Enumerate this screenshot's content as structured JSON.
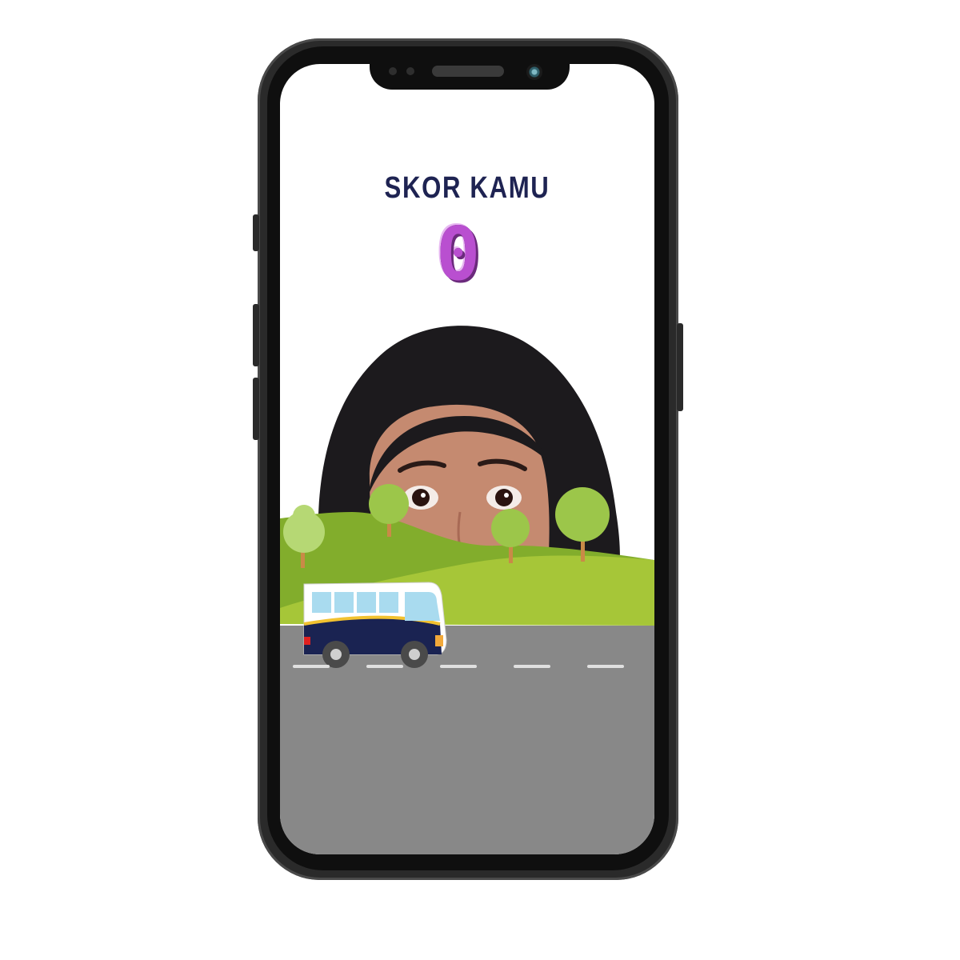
{
  "score": {
    "label": "SKOR KAMU",
    "value": "0"
  },
  "scene": {
    "vehicle": "bus-icon",
    "background": "hills-with-trees",
    "person": "peeking-face"
  },
  "colors": {
    "score_label": "#1e2352",
    "score_value": "#b94fd0",
    "hill_light": "#a6c638",
    "hill_dark": "#82ad2c",
    "road": "#888888",
    "bus_navy": "#1a2352",
    "bus_window": "#a9dbef"
  }
}
